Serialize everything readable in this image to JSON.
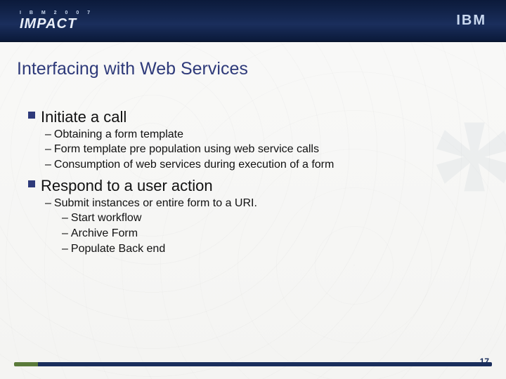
{
  "header": {
    "event_pre": "I B M  2 0 0 7",
    "event_main": "IMPACT",
    "company": "IBM"
  },
  "title": "Interfacing with Web Services",
  "watermark": "*",
  "bullets": [
    {
      "text": "Initiate a call",
      "children": [
        {
          "text": "Obtaining a form template"
        },
        {
          "text": "Form template pre population using web service calls"
        },
        {
          "text": "Consumption of web services during execution of a form"
        }
      ]
    },
    {
      "text": "Respond to a user action",
      "children": [
        {
          "text": "Submit instances or entire form to a URI.",
          "children": [
            {
              "text": "Start workflow"
            },
            {
              "text": "Archive Form"
            },
            {
              "text": "Populate Back end"
            }
          ]
        }
      ]
    }
  ],
  "page_number": "17"
}
